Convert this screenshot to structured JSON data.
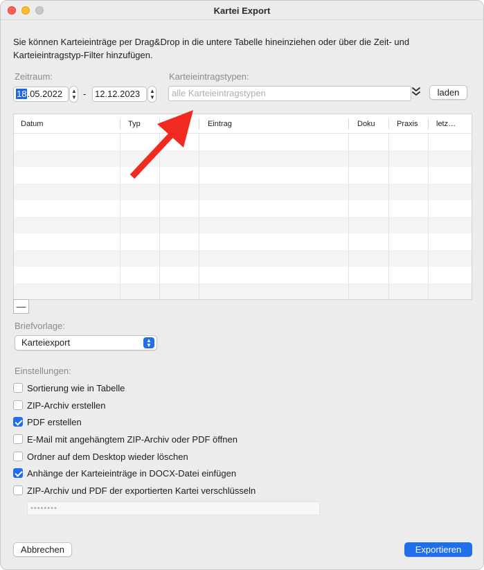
{
  "window": {
    "title": "Kartei Export"
  },
  "intro_text": "Sie können Karteieinträge per Drag&Drop in die untere Tabelle hineinziehen oder über die Zeit- und Karteieintragstyp-Filter hinzufügen.",
  "zeitraum": {
    "label": "Zeitraum:",
    "from_selected": "18",
    "from_rest": ".05.2022",
    "separator": "-",
    "to": "12.12.2023"
  },
  "types": {
    "label": "Karteieintragstypen:",
    "placeholder": "alle Karteieintragstypen",
    "load_button": "laden"
  },
  "table": {
    "columns": [
      "Datum",
      "Typ",
      "",
      "Eintrag",
      "Doku",
      "Praxis",
      "letz…"
    ],
    "rows": []
  },
  "remove_button": "—",
  "briefvorlage": {
    "label": "Briefvorlage:",
    "selected": "Karteiexport"
  },
  "einstellungen": {
    "label": "Einstellungen:",
    "options": [
      {
        "label": "Sortierung wie in Tabelle",
        "checked": false
      },
      {
        "label": "ZIP-Archiv erstellen",
        "checked": false
      },
      {
        "label": "PDF erstellen",
        "checked": true
      },
      {
        "label": "E-Mail mit angehängtem ZIP-Archiv oder PDF öffnen",
        "checked": false
      },
      {
        "label": "Ordner auf dem Desktop wieder löschen",
        "checked": false
      },
      {
        "label": "Anhänge der Karteieinträge in DOCX-Datei einfügen",
        "checked": true
      },
      {
        "label": "ZIP-Archiv und PDF der exportierten Kartei verschlüsseln",
        "checked": false
      }
    ],
    "password_mask": "••••••••"
  },
  "footer": {
    "cancel": "Abbrechen",
    "export": "Exportieren"
  },
  "colors": {
    "accent": "#1f6fea",
    "annotation_arrow": "#f02a1f"
  }
}
